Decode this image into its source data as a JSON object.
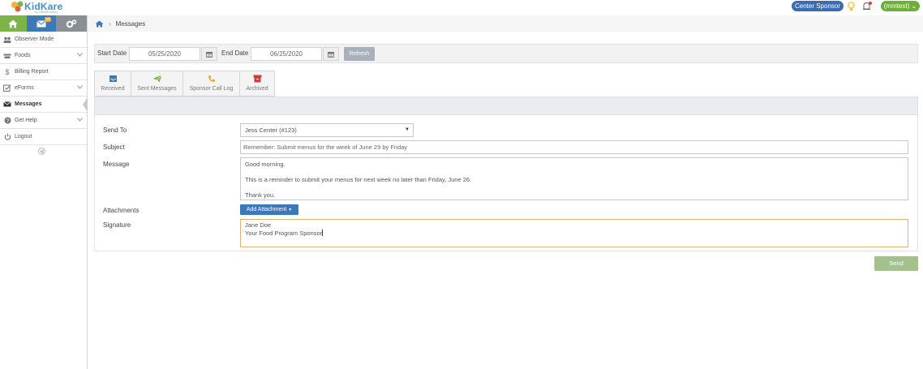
{
  "app": {
    "logo_text": "KidKare",
    "logo_subtext": "by Minute Menu",
    "colors": {
      "accent_blue": "#3d78b8",
      "accent_green": "#7db44a",
      "sponsor_pill": "#3b6cae",
      "user_pill": "#6fae3c",
      "send_button": "#a3c28b"
    }
  },
  "topbar": {
    "sponsor_label": "Center Sponsor",
    "user_label": "(mmtest)",
    "icons": [
      "lightbulb-icon",
      "bell-icon",
      "chevron-down-icon"
    ]
  },
  "sidebar": {
    "top_icons": [
      "home-icon",
      "mail-icon",
      "gear-icon"
    ],
    "mail_badge": "99",
    "items": [
      {
        "label": "Observer Mode",
        "icon": "users-icon",
        "has_chevron": false
      },
      {
        "label": "Foods",
        "icon": "food-icon",
        "has_chevron": true
      },
      {
        "label": "Billing Report",
        "icon": "dollar-icon",
        "has_chevron": false
      },
      {
        "label": "eForms",
        "icon": "check-form-icon",
        "has_chevron": true
      },
      {
        "label": "Messages",
        "icon": "envelope-icon",
        "has_chevron": false,
        "active": true
      },
      {
        "label": "Get Help",
        "icon": "help-icon",
        "has_chevron": true
      },
      {
        "label": "Logout",
        "icon": "power-icon",
        "has_chevron": false
      }
    ]
  },
  "breadcrumb": {
    "current": "Messages"
  },
  "filter": {
    "start_label": "Start Date",
    "start_value": "05/25/2020",
    "end_label": "End Date",
    "end_value": "06/25/2020",
    "refresh_label": "Refresh"
  },
  "tabs": [
    {
      "label": "Received",
      "icon": "inbox-icon"
    },
    {
      "label": "Sent Messages",
      "icon": "paper-plane-icon"
    },
    {
      "label": "Sponsor Call Log",
      "icon": "phone-icon"
    },
    {
      "label": "Archived",
      "icon": "archive-icon"
    }
  ],
  "form": {
    "send_to_label": "Send To",
    "send_to_value": "Jess Center (#123)",
    "subject_label": "Subject",
    "subject_value": "Remember: Submit menus for the week of June 29 by Friday",
    "message_label": "Message",
    "message_lines": [
      "Good morning.",
      "This is a reminder to submit your menus for next week no later than Friday, June 26.",
      "Thank you."
    ],
    "attachments_label": "Attachments",
    "add_attachment_label": "Add Attachment",
    "signature_label": "Signature",
    "signature_lines": [
      "Jane Doe",
      "Your Food Program Sponsor"
    ]
  },
  "send_label": "Send"
}
